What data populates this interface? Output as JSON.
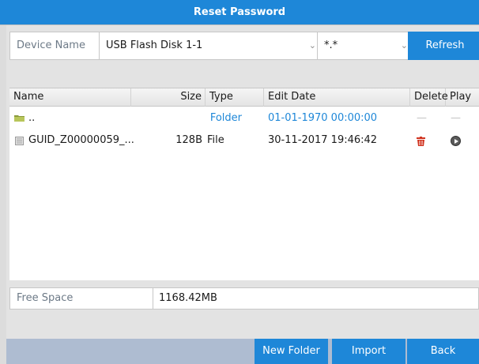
{
  "window": {
    "title": "Reset Password"
  },
  "device": {
    "label": "Device Name",
    "selected": "USB Flash Disk 1-1",
    "filter": "*.*",
    "refresh_label": "Refresh"
  },
  "table": {
    "columns": [
      "Name",
      "Size",
      "Type",
      "Edit Date",
      "Delete",
      "Play"
    ],
    "rows": [
      {
        "name": "..",
        "size": "",
        "type": "Folder",
        "edit_date": "01-01-1970 00:00:00",
        "delete": "—",
        "play": "—"
      },
      {
        "name": "GUID_Z00000059_...",
        "size": "128B",
        "type": "File",
        "edit_date": "30-11-2017 19:46:42"
      }
    ]
  },
  "free_space": {
    "label": "Free Space",
    "value": "1168.42MB"
  },
  "footer": {
    "new_folder_label": "New Folder",
    "import_label": "Import",
    "back_label": "Back"
  },
  "icons": {
    "folder": "folder-icon",
    "file": "file-icon",
    "delete": "trash-icon",
    "play": "play-icon",
    "dropdown": "chevron-down-icon"
  },
  "colors": {
    "accent": "#1e87d8",
    "delete": "#d0321e",
    "footer": "#aebcd1"
  }
}
